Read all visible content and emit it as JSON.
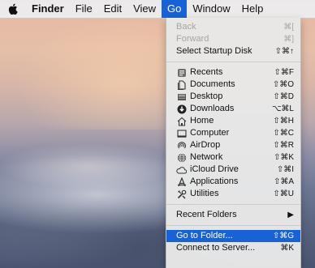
{
  "menubar": {
    "app_name": "Finder",
    "menus": [
      "File",
      "Edit",
      "View",
      "Go",
      "Window",
      "Help"
    ],
    "active_menu": "Go"
  },
  "go_menu": {
    "back": {
      "label": "Back",
      "shortcut": "⌘["
    },
    "forward": {
      "label": "Forward",
      "shortcut": "⌘]"
    },
    "startup": {
      "label": "Select Startup Disk",
      "shortcut": "⇧⌘↑"
    },
    "places": [
      {
        "label": "Recents",
        "shortcut": "⇧⌘F",
        "icon": "recents-icon"
      },
      {
        "label": "Documents",
        "shortcut": "⇧⌘O",
        "icon": "documents-icon"
      },
      {
        "label": "Desktop",
        "shortcut": "⇧⌘D",
        "icon": "desktop-icon"
      },
      {
        "label": "Downloads",
        "shortcut": "⌥⌘L",
        "icon": "downloads-icon"
      },
      {
        "label": "Home",
        "shortcut": "⇧⌘H",
        "icon": "home-icon"
      },
      {
        "label": "Computer",
        "shortcut": "⇧⌘C",
        "icon": "computer-icon"
      },
      {
        "label": "AirDrop",
        "shortcut": "⇧⌘R",
        "icon": "airdrop-icon"
      },
      {
        "label": "Network",
        "shortcut": "⇧⌘K",
        "icon": "network-icon"
      },
      {
        "label": "iCloud Drive",
        "shortcut": "⇧⌘I",
        "icon": "icloud-icon"
      },
      {
        "label": "Applications",
        "shortcut": "⇧⌘A",
        "icon": "applications-icon"
      },
      {
        "label": "Utilities",
        "shortcut": "⇧⌘U",
        "icon": "utilities-icon"
      }
    ],
    "recent_folders": {
      "label": "Recent Folders",
      "arrow": "▶"
    },
    "go_to_folder": {
      "label": "Go to Folder...",
      "shortcut": "⇧⌘G"
    },
    "connect": {
      "label": "Connect to Server...",
      "shortcut": "⌘K"
    }
  },
  "colors": {
    "highlight": "#1862d8",
    "menubar_bg": "#ececec",
    "disabled_text": "#a5a5a5"
  }
}
